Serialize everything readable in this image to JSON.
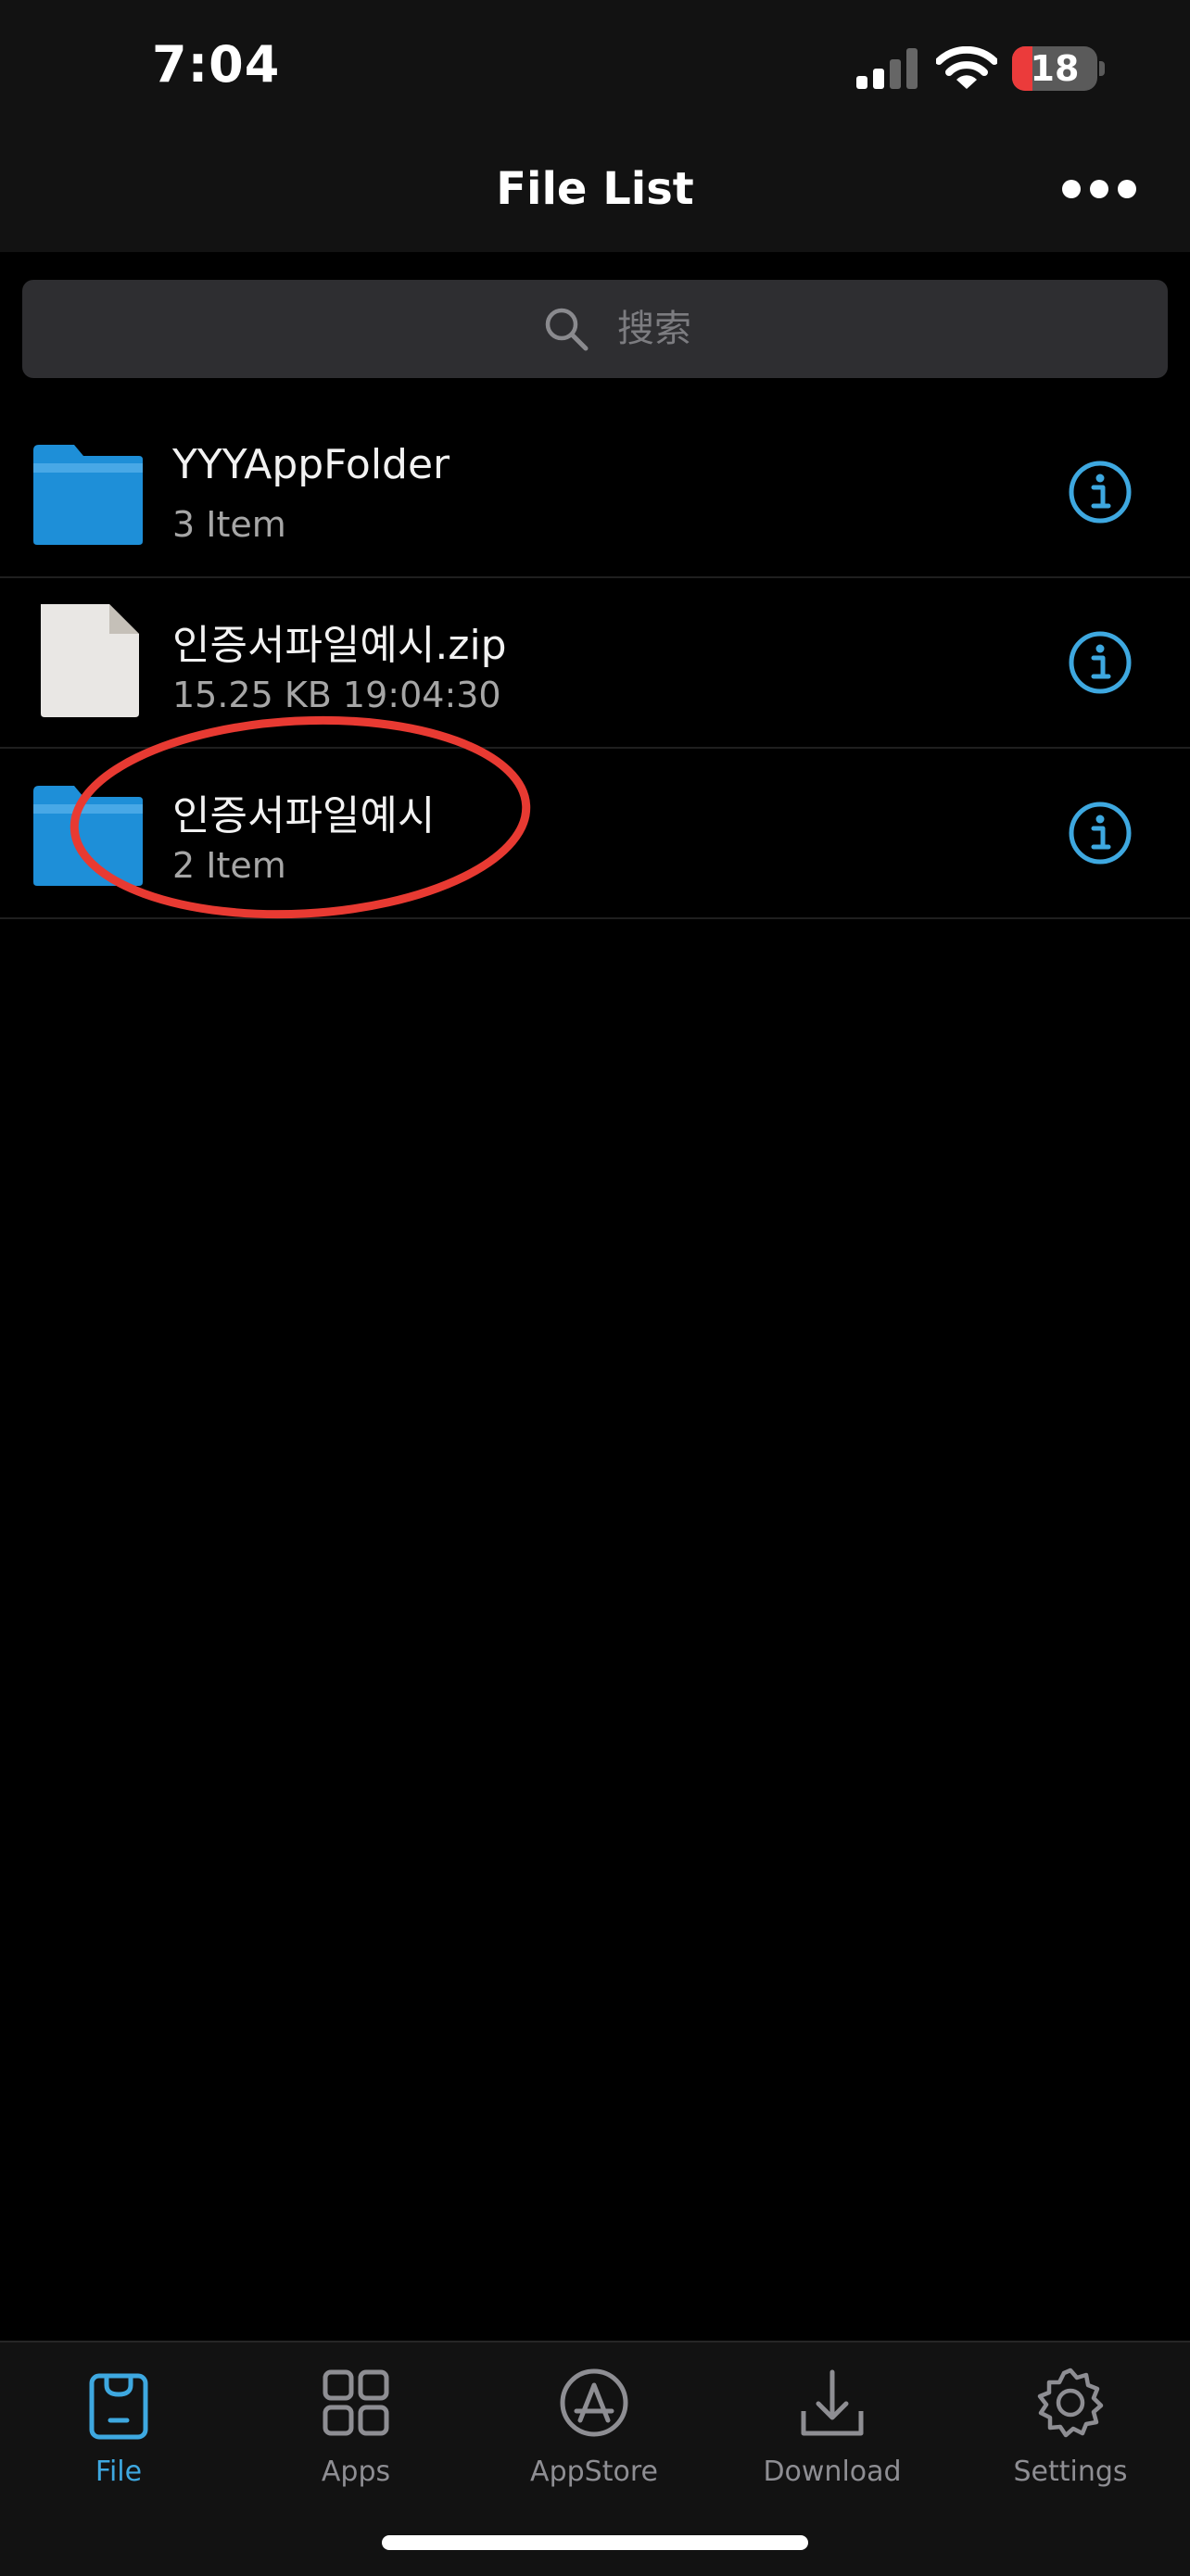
{
  "status_bar": {
    "time": "7:04",
    "battery": "18"
  },
  "header": {
    "title": "File List"
  },
  "search": {
    "placeholder": "搜索"
  },
  "files": [
    {
      "name": "YYYAppFolder",
      "detail": "3 Item",
      "type": "folder"
    },
    {
      "name": "인증서파일예시.zip",
      "detail": "15.25 KB   19:04:30",
      "type": "file"
    },
    {
      "name": "인증서파일예시",
      "detail": "2 Item",
      "type": "folder"
    }
  ],
  "tabs": [
    {
      "label": "File",
      "icon": "file-tab-icon",
      "active": true
    },
    {
      "label": "Apps",
      "icon": "apps-grid-icon",
      "active": false
    },
    {
      "label": "AppStore",
      "icon": "appstore-icon",
      "active": false
    },
    {
      "label": "Download",
      "icon": "download-icon",
      "active": false
    },
    {
      "label": "Settings",
      "icon": "gear-icon",
      "active": false
    }
  ],
  "colors": {
    "accent": "#3ea8e0",
    "folder": "#1e8fd8",
    "annotation": "#e83a32",
    "background": "#000000",
    "bar": "#121212"
  }
}
